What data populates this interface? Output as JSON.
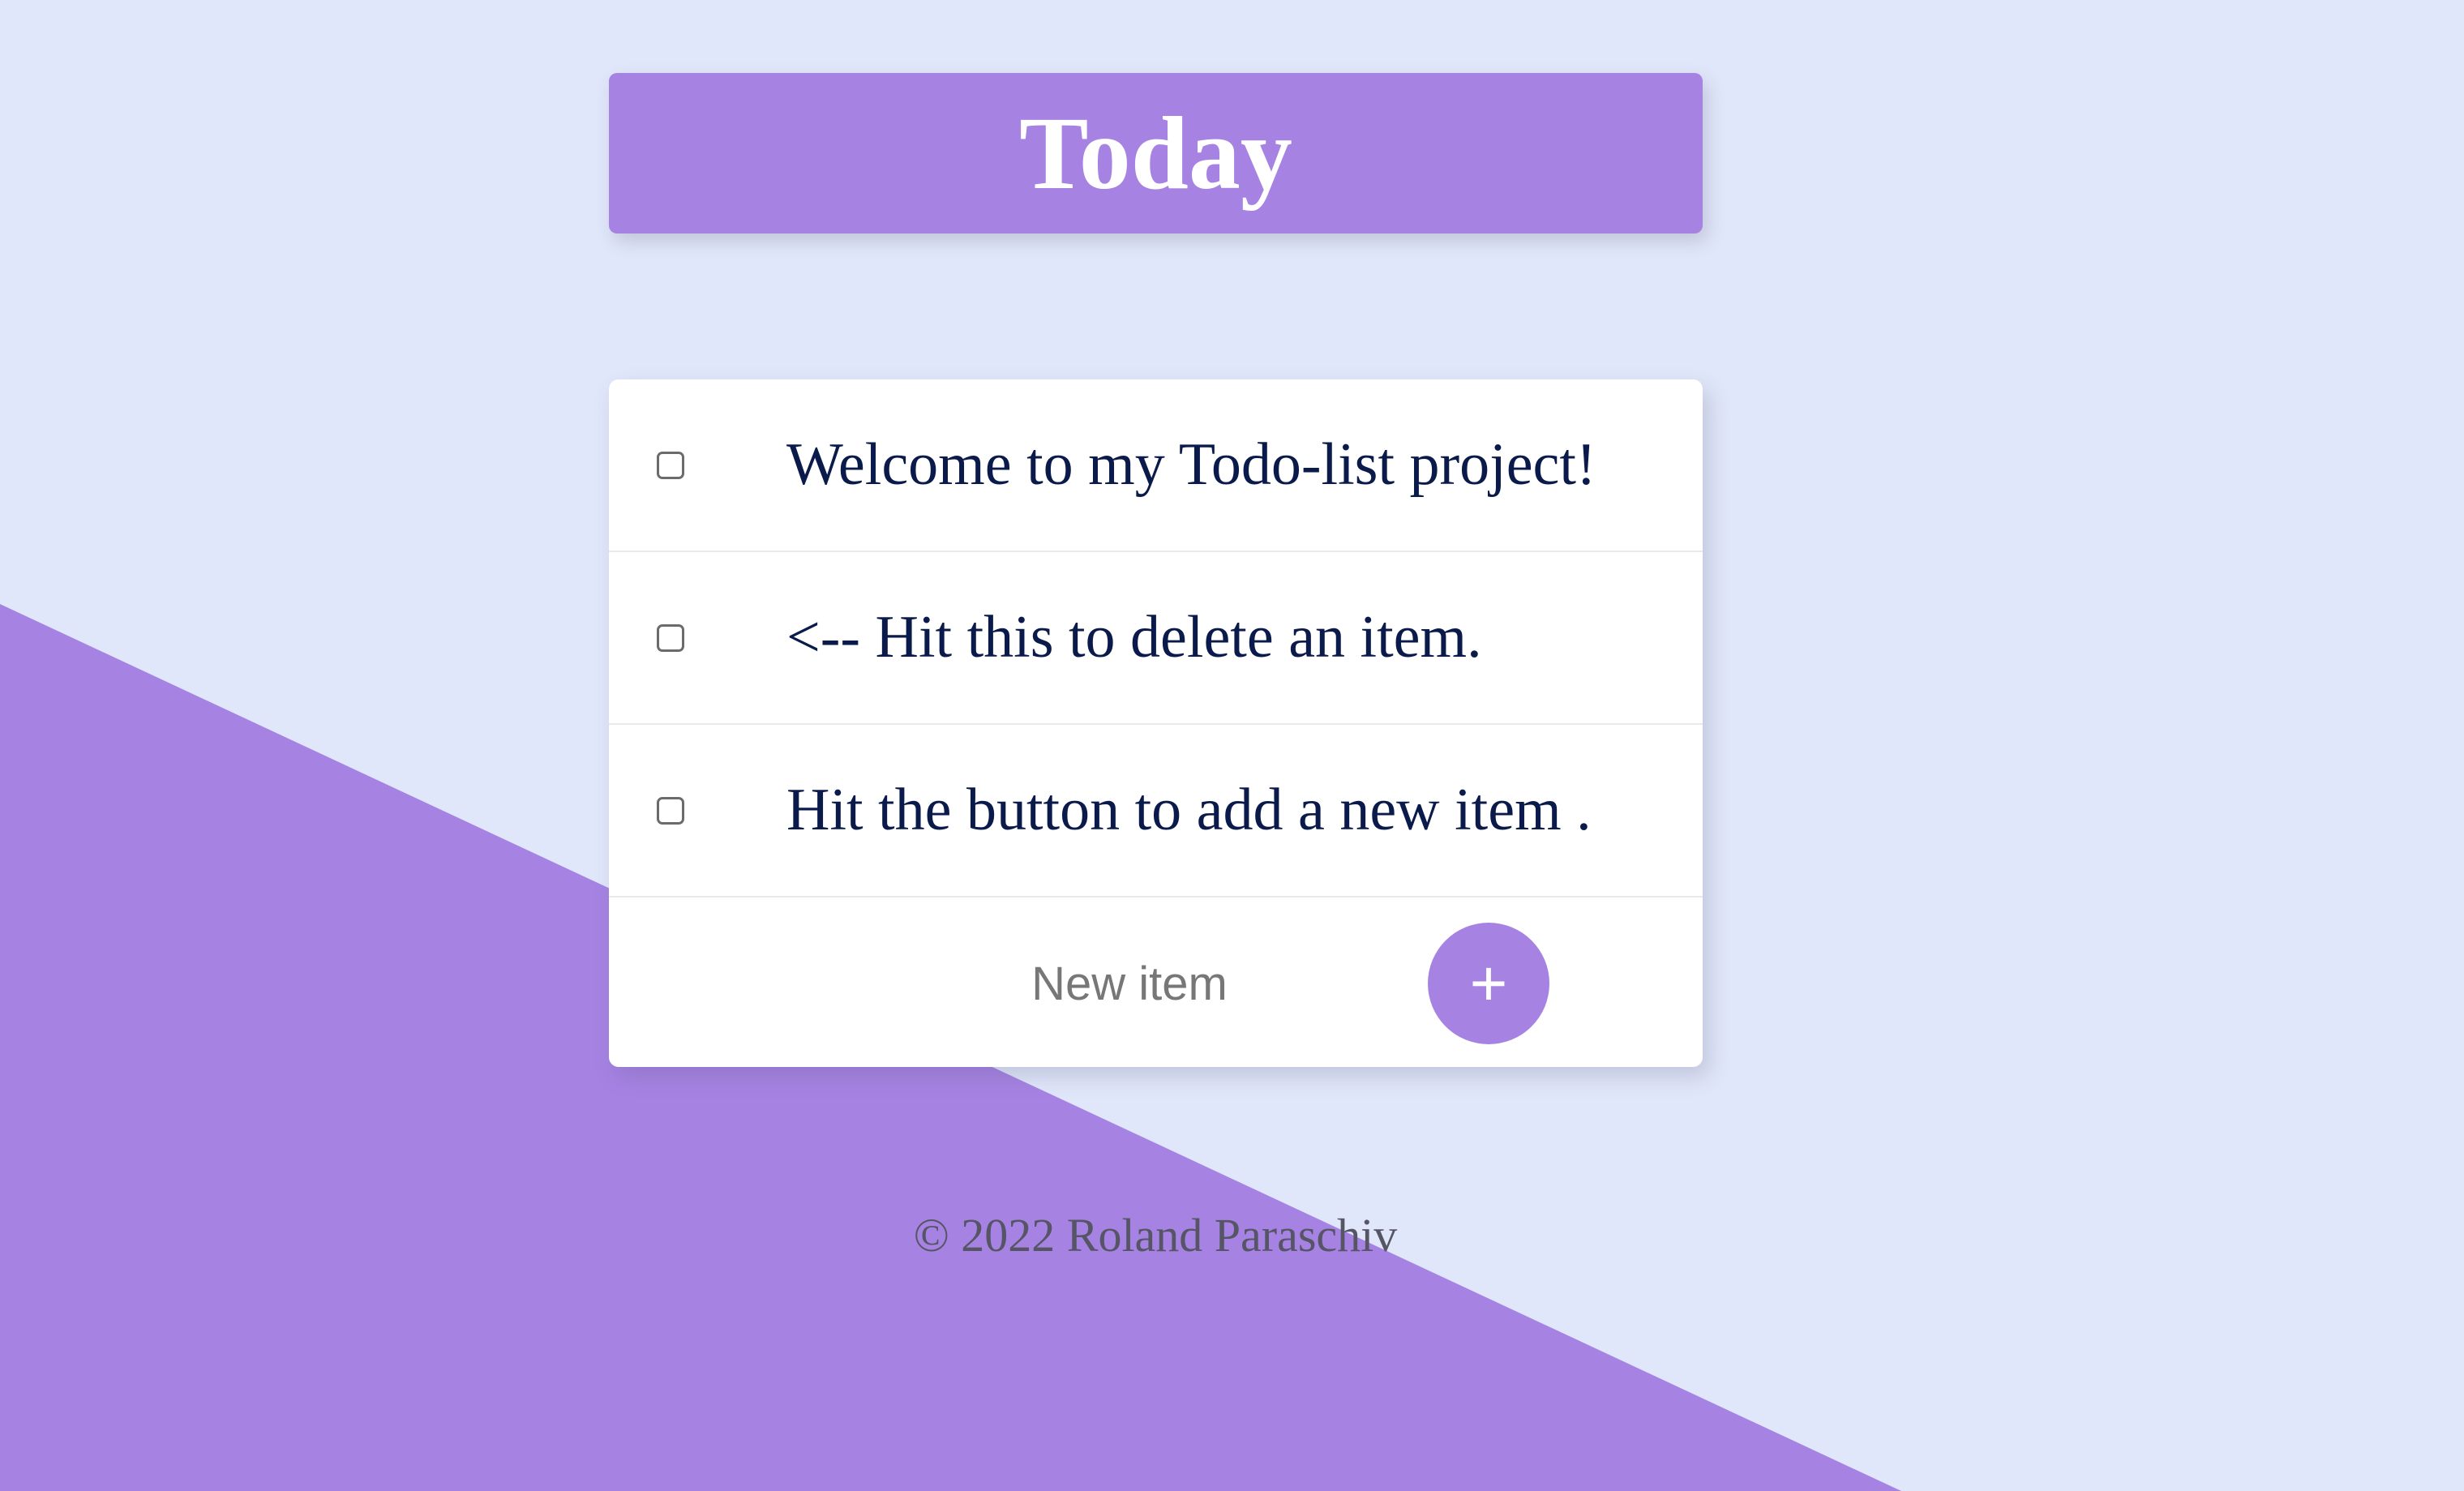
{
  "header": {
    "title": "Today"
  },
  "todo": {
    "items": [
      {
        "label": "Welcome to my Todo-list project!"
      },
      {
        "label": "<-- Hit this to delete an item."
      },
      {
        "label": "Hit the button to add a new item ."
      }
    ],
    "new_item": {
      "placeholder": "New item",
      "value": ""
    },
    "add_button_label": "+"
  },
  "footer": {
    "text": "© 2022 Roland Paraschiv"
  },
  "colors": {
    "background": "#e1e7fa",
    "accent": "#a683e3",
    "item_text": "#0a1a4a",
    "card": "#ffffff"
  }
}
